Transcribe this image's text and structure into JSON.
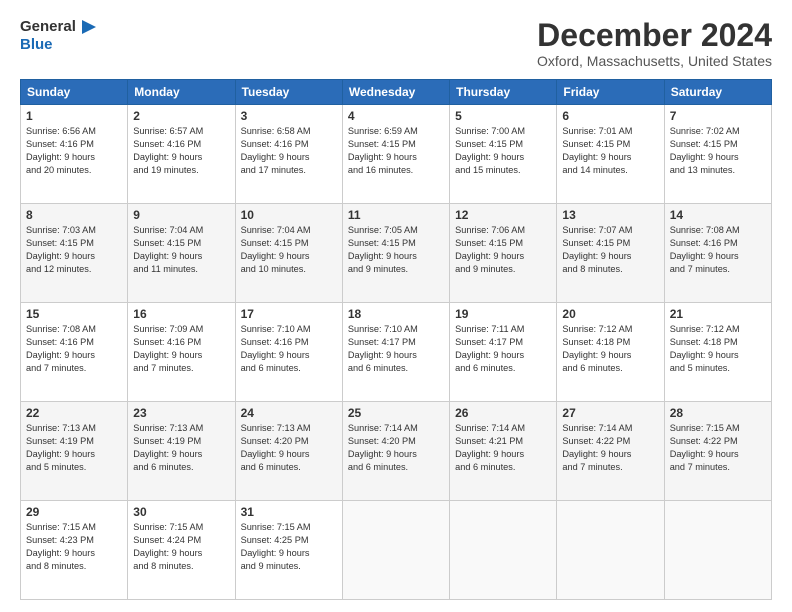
{
  "header": {
    "logo_line1": "General",
    "logo_line2": "Blue",
    "month": "December 2024",
    "location": "Oxford, Massachusetts, United States"
  },
  "days": [
    "Sunday",
    "Monday",
    "Tuesday",
    "Wednesday",
    "Thursday",
    "Friday",
    "Saturday"
  ],
  "weeks": [
    [
      {
        "num": "1",
        "info": "Sunrise: 6:56 AM\nSunset: 4:16 PM\nDaylight: 9 hours\nand 20 minutes."
      },
      {
        "num": "2",
        "info": "Sunrise: 6:57 AM\nSunset: 4:16 PM\nDaylight: 9 hours\nand 19 minutes."
      },
      {
        "num": "3",
        "info": "Sunrise: 6:58 AM\nSunset: 4:16 PM\nDaylight: 9 hours\nand 17 minutes."
      },
      {
        "num": "4",
        "info": "Sunrise: 6:59 AM\nSunset: 4:15 PM\nDaylight: 9 hours\nand 16 minutes."
      },
      {
        "num": "5",
        "info": "Sunrise: 7:00 AM\nSunset: 4:15 PM\nDaylight: 9 hours\nand 15 minutes."
      },
      {
        "num": "6",
        "info": "Sunrise: 7:01 AM\nSunset: 4:15 PM\nDaylight: 9 hours\nand 14 minutes."
      },
      {
        "num": "7",
        "info": "Sunrise: 7:02 AM\nSunset: 4:15 PM\nDaylight: 9 hours\nand 13 minutes."
      }
    ],
    [
      {
        "num": "8",
        "info": "Sunrise: 7:03 AM\nSunset: 4:15 PM\nDaylight: 9 hours\nand 12 minutes."
      },
      {
        "num": "9",
        "info": "Sunrise: 7:04 AM\nSunset: 4:15 PM\nDaylight: 9 hours\nand 11 minutes."
      },
      {
        "num": "10",
        "info": "Sunrise: 7:04 AM\nSunset: 4:15 PM\nDaylight: 9 hours\nand 10 minutes."
      },
      {
        "num": "11",
        "info": "Sunrise: 7:05 AM\nSunset: 4:15 PM\nDaylight: 9 hours\nand 9 minutes."
      },
      {
        "num": "12",
        "info": "Sunrise: 7:06 AM\nSunset: 4:15 PM\nDaylight: 9 hours\nand 9 minutes."
      },
      {
        "num": "13",
        "info": "Sunrise: 7:07 AM\nSunset: 4:15 PM\nDaylight: 9 hours\nand 8 minutes."
      },
      {
        "num": "14",
        "info": "Sunrise: 7:08 AM\nSunset: 4:16 PM\nDaylight: 9 hours\nand 7 minutes."
      }
    ],
    [
      {
        "num": "15",
        "info": "Sunrise: 7:08 AM\nSunset: 4:16 PM\nDaylight: 9 hours\nand 7 minutes."
      },
      {
        "num": "16",
        "info": "Sunrise: 7:09 AM\nSunset: 4:16 PM\nDaylight: 9 hours\nand 7 minutes."
      },
      {
        "num": "17",
        "info": "Sunrise: 7:10 AM\nSunset: 4:16 PM\nDaylight: 9 hours\nand 6 minutes."
      },
      {
        "num": "18",
        "info": "Sunrise: 7:10 AM\nSunset: 4:17 PM\nDaylight: 9 hours\nand 6 minutes."
      },
      {
        "num": "19",
        "info": "Sunrise: 7:11 AM\nSunset: 4:17 PM\nDaylight: 9 hours\nand 6 minutes."
      },
      {
        "num": "20",
        "info": "Sunrise: 7:12 AM\nSunset: 4:18 PM\nDaylight: 9 hours\nand 6 minutes."
      },
      {
        "num": "21",
        "info": "Sunrise: 7:12 AM\nSunset: 4:18 PM\nDaylight: 9 hours\nand 5 minutes."
      }
    ],
    [
      {
        "num": "22",
        "info": "Sunrise: 7:13 AM\nSunset: 4:19 PM\nDaylight: 9 hours\nand 5 minutes."
      },
      {
        "num": "23",
        "info": "Sunrise: 7:13 AM\nSunset: 4:19 PM\nDaylight: 9 hours\nand 6 minutes."
      },
      {
        "num": "24",
        "info": "Sunrise: 7:13 AM\nSunset: 4:20 PM\nDaylight: 9 hours\nand 6 minutes."
      },
      {
        "num": "25",
        "info": "Sunrise: 7:14 AM\nSunset: 4:20 PM\nDaylight: 9 hours\nand 6 minutes."
      },
      {
        "num": "26",
        "info": "Sunrise: 7:14 AM\nSunset: 4:21 PM\nDaylight: 9 hours\nand 6 minutes."
      },
      {
        "num": "27",
        "info": "Sunrise: 7:14 AM\nSunset: 4:22 PM\nDaylight: 9 hours\nand 7 minutes."
      },
      {
        "num": "28",
        "info": "Sunrise: 7:15 AM\nSunset: 4:22 PM\nDaylight: 9 hours\nand 7 minutes."
      }
    ],
    [
      {
        "num": "29",
        "info": "Sunrise: 7:15 AM\nSunset: 4:23 PM\nDaylight: 9 hours\nand 8 minutes."
      },
      {
        "num": "30",
        "info": "Sunrise: 7:15 AM\nSunset: 4:24 PM\nDaylight: 9 hours\nand 8 minutes."
      },
      {
        "num": "31",
        "info": "Sunrise: 7:15 AM\nSunset: 4:25 PM\nDaylight: 9 hours\nand 9 minutes."
      },
      null,
      null,
      null,
      null
    ]
  ]
}
